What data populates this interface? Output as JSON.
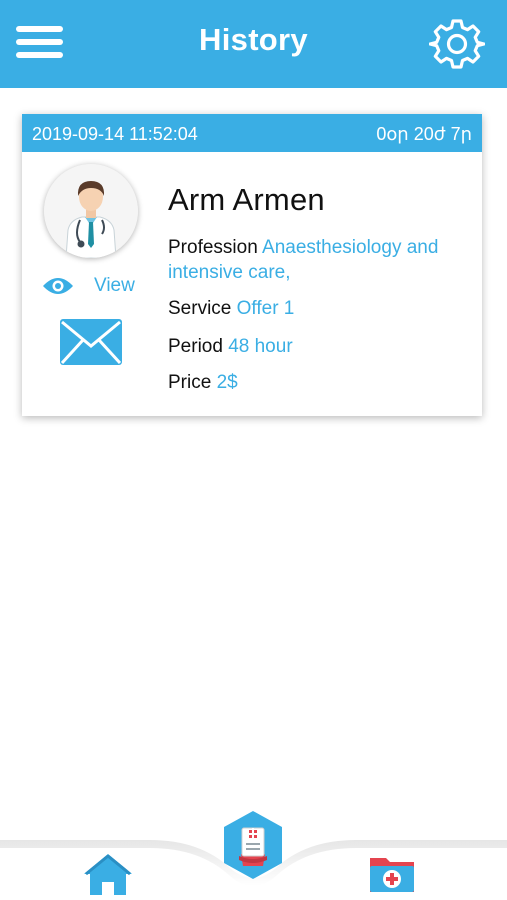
{
  "header": {
    "title": "History",
    "menu_icon": "hamburger-menu-icon",
    "settings_icon": "gear-icon"
  },
  "card": {
    "date": "2019-09-14 11:52:04",
    "remaining": "0օր 20ժ 7ր",
    "name": "Arm Armen",
    "view_label": "View",
    "profession": {
      "label": "Profession",
      "value": "Anaesthesiology and intensive care,"
    },
    "service": {
      "label": "Service",
      "value": "Offer 1"
    },
    "period": {
      "label": "Period",
      "value": "48 hour"
    },
    "price": {
      "label": "Price",
      "value": "2$"
    }
  },
  "tabbar": {
    "items": [
      "home-icon",
      "medical-record-icon",
      "medical-folder-icon"
    ]
  },
  "colors": {
    "accent": "#3aaee4",
    "text": "#111111",
    "background": "#ffffff",
    "medical_red": "#e4444f"
  }
}
